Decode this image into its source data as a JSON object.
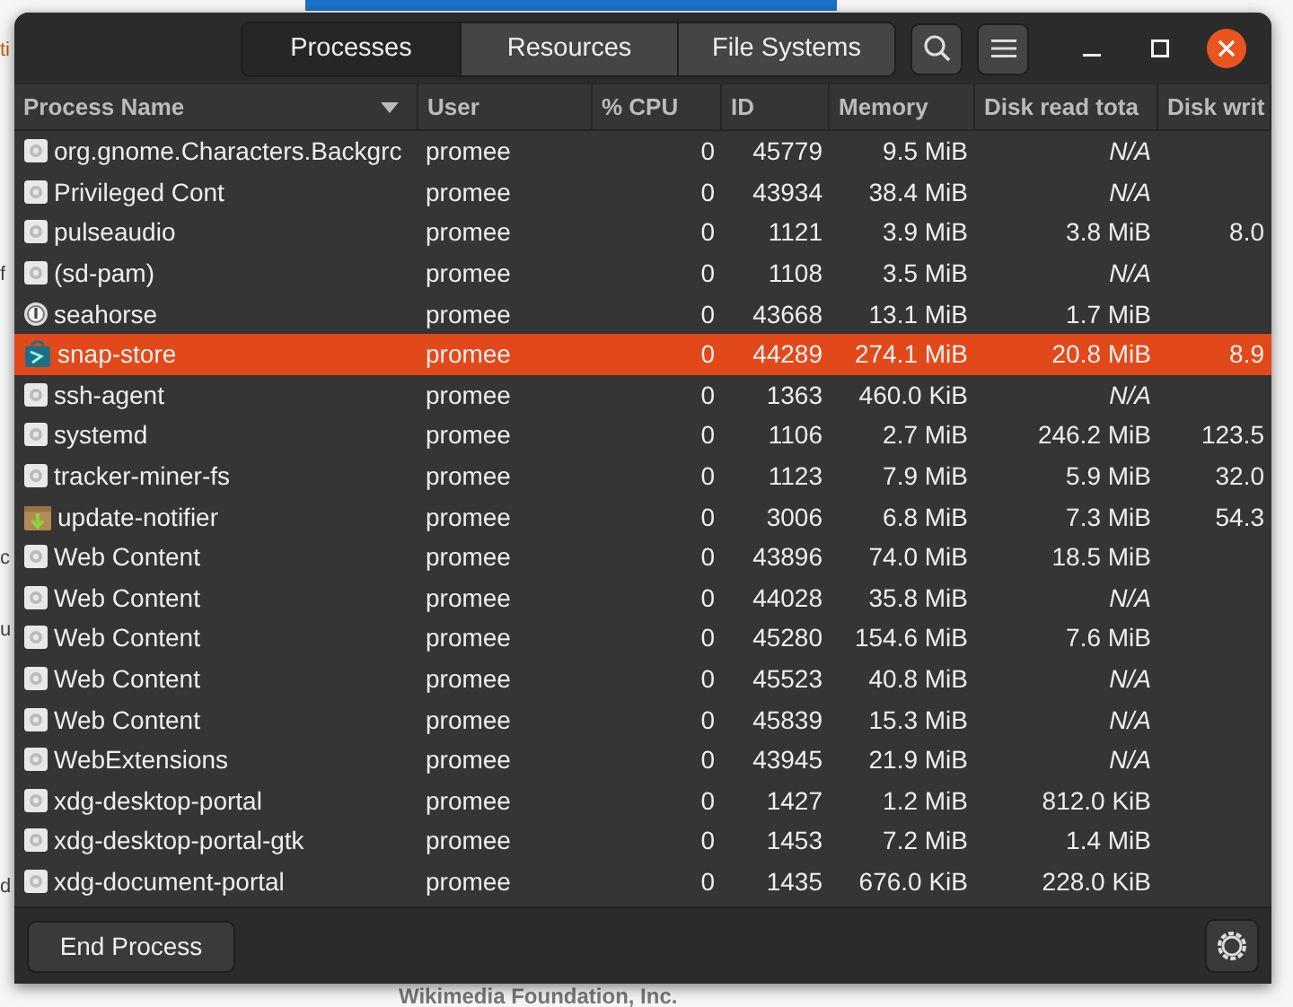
{
  "background": {
    "fragments": [
      "ti",
      "f",
      "c",
      "u",
      "d"
    ],
    "footer_text": "Wikimedia Foundation, Inc."
  },
  "tabs": [
    {
      "label": "Processes",
      "selected": true
    },
    {
      "label": "Resources",
      "selected": false
    },
    {
      "label": "File Systems",
      "selected": false
    }
  ],
  "table": {
    "columns": [
      "Process Name",
      "User",
      "% CPU",
      "ID",
      "Memory",
      "Disk read tota",
      "Disk writ"
    ],
    "rows": [
      {
        "kind": "generic",
        "name": "org.gnome.Characters.Backgrc",
        "user": "promee",
        "cpu": "0",
        "id": "45779",
        "memory": "9.5 MiB",
        "disk_read": "N/A",
        "selected": false
      },
      {
        "kind": "generic",
        "name": "Privileged Cont",
        "user": "promee",
        "cpu": "0",
        "id": "43934",
        "memory": "38.4 MiB",
        "disk_read": "N/A",
        "selected": false
      },
      {
        "kind": "generic",
        "name": "pulseaudio",
        "user": "promee",
        "cpu": "0",
        "id": "1121",
        "memory": "3.9 MiB",
        "disk_read": "3.8 MiB",
        "disk_write": "8.0",
        "selected": false
      },
      {
        "kind": "generic",
        "name": "(sd-pam)",
        "user": "promee",
        "cpu": "0",
        "id": "1108",
        "memory": "3.5 MiB",
        "disk_read": "N/A",
        "selected": false
      },
      {
        "kind": "seahorse",
        "name": "seahorse",
        "user": "promee",
        "cpu": "0",
        "id": "43668",
        "memory": "13.1 MiB",
        "disk_read": "1.7 MiB",
        "selected": false
      },
      {
        "kind": "snap",
        "name": "snap-store",
        "user": "promee",
        "cpu": "0",
        "id": "44289",
        "memory": "274.1 MiB",
        "disk_read": "20.8 MiB",
        "disk_write": "8.9",
        "selected": true
      },
      {
        "kind": "generic",
        "name": "ssh-agent",
        "user": "promee",
        "cpu": "0",
        "id": "1363",
        "memory": "460.0 KiB",
        "disk_read": "N/A",
        "selected": false
      },
      {
        "kind": "generic",
        "name": "systemd",
        "user": "promee",
        "cpu": "0",
        "id": "1106",
        "memory": "2.7 MiB",
        "disk_read": "246.2 MiB",
        "disk_write": "123.5",
        "selected": false
      },
      {
        "kind": "generic",
        "name": "tracker-miner-fs",
        "user": "promee",
        "cpu": "0",
        "id": "1123",
        "memory": "7.9 MiB",
        "disk_read": "5.9 MiB",
        "disk_write": "32.0",
        "selected": false
      },
      {
        "kind": "package",
        "name": "update-notifier",
        "user": "promee",
        "cpu": "0",
        "id": "3006",
        "memory": "6.8 MiB",
        "disk_read": "7.3 MiB",
        "disk_write": "54.3",
        "selected": false
      },
      {
        "kind": "generic",
        "name": "Web Content",
        "user": "promee",
        "cpu": "0",
        "id": "43896",
        "memory": "74.0 MiB",
        "disk_read": "18.5 MiB",
        "selected": false
      },
      {
        "kind": "generic",
        "name": "Web Content",
        "user": "promee",
        "cpu": "0",
        "id": "44028",
        "memory": "35.8 MiB",
        "disk_read": "N/A",
        "selected": false
      },
      {
        "kind": "generic",
        "name": "Web Content",
        "user": "promee",
        "cpu": "0",
        "id": "45280",
        "memory": "154.6 MiB",
        "disk_read": "7.6 MiB",
        "selected": false
      },
      {
        "kind": "generic",
        "name": "Web Content",
        "user": "promee",
        "cpu": "0",
        "id": "45523",
        "memory": "40.8 MiB",
        "disk_read": "N/A",
        "selected": false
      },
      {
        "kind": "generic",
        "name": "Web Content",
        "user": "promee",
        "cpu": "0",
        "id": "45839",
        "memory": "15.3 MiB",
        "disk_read": "N/A",
        "selected": false
      },
      {
        "kind": "generic",
        "name": "WebExtensions",
        "user": "promee",
        "cpu": "0",
        "id": "43945",
        "memory": "21.9 MiB",
        "disk_read": "N/A",
        "selected": false
      },
      {
        "kind": "generic",
        "name": "xdg-desktop-portal",
        "user": "promee",
        "cpu": "0",
        "id": "1427",
        "memory": "1.2 MiB",
        "disk_read": "812.0 KiB",
        "selected": false
      },
      {
        "kind": "generic",
        "name": "xdg-desktop-portal-gtk",
        "user": "promee",
        "cpu": "0",
        "id": "1453",
        "memory": "7.2 MiB",
        "disk_read": "1.4 MiB",
        "selected": false
      },
      {
        "kind": "generic",
        "name": "xdg-document-portal",
        "user": "promee",
        "cpu": "0",
        "id": "1435",
        "memory": "676.0 KiB",
        "disk_read": "228.0 KiB",
        "selected": false
      }
    ]
  },
  "footer": {
    "button": "End Process"
  }
}
